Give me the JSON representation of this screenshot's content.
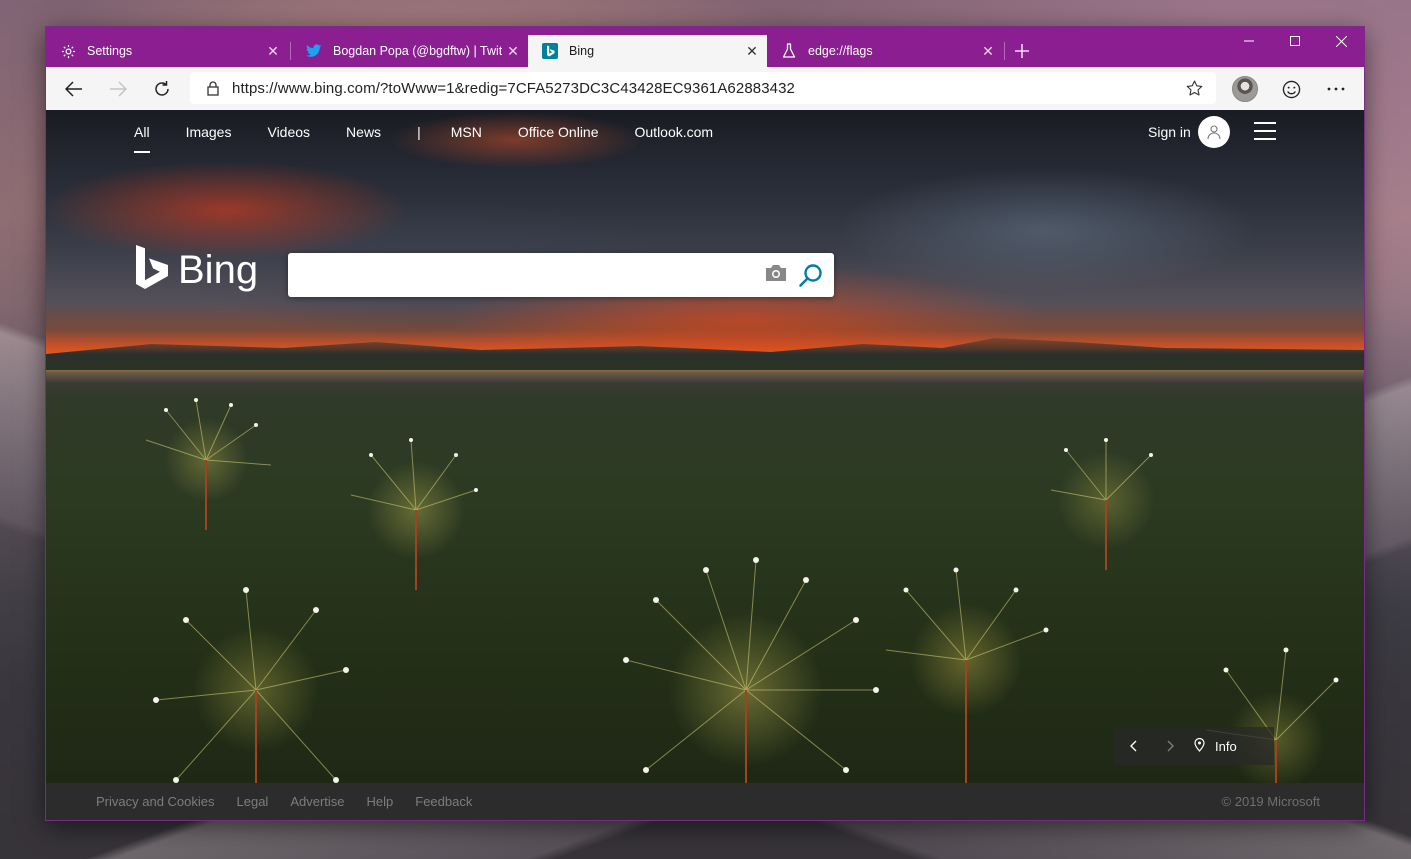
{
  "tabs": [
    {
      "label": "Settings",
      "icon": "gear-icon",
      "active": false
    },
    {
      "label": "Bogdan Popa (@bgdftw) | Twitte",
      "icon": "twitter-icon",
      "active": false
    },
    {
      "label": "Bing",
      "icon": "bing-icon",
      "active": true
    },
    {
      "label": "edge://flags",
      "icon": "flask-icon",
      "active": false
    }
  ],
  "toolbar": {
    "url": "https://www.bing.com/?toWww=1&redig=7CFA5273DC3C43428EC9361A62883432"
  },
  "bing": {
    "nav": [
      "All",
      "Images",
      "Videos",
      "News",
      "|",
      "MSN",
      "Office Online",
      "Outlook.com"
    ],
    "signin": "Sign in",
    "logo_text": "Bing",
    "search_placeholder": "",
    "info_label": "Info"
  },
  "footer": {
    "links": [
      "Privacy and Cookies",
      "Legal",
      "Advertise",
      "Help",
      "Feedback"
    ],
    "copyright": "© 2019 Microsoft"
  },
  "colors": {
    "titlebar": "#8b1e91",
    "toolbar": "#f5f5f5",
    "bing_accent": "#007daa"
  }
}
